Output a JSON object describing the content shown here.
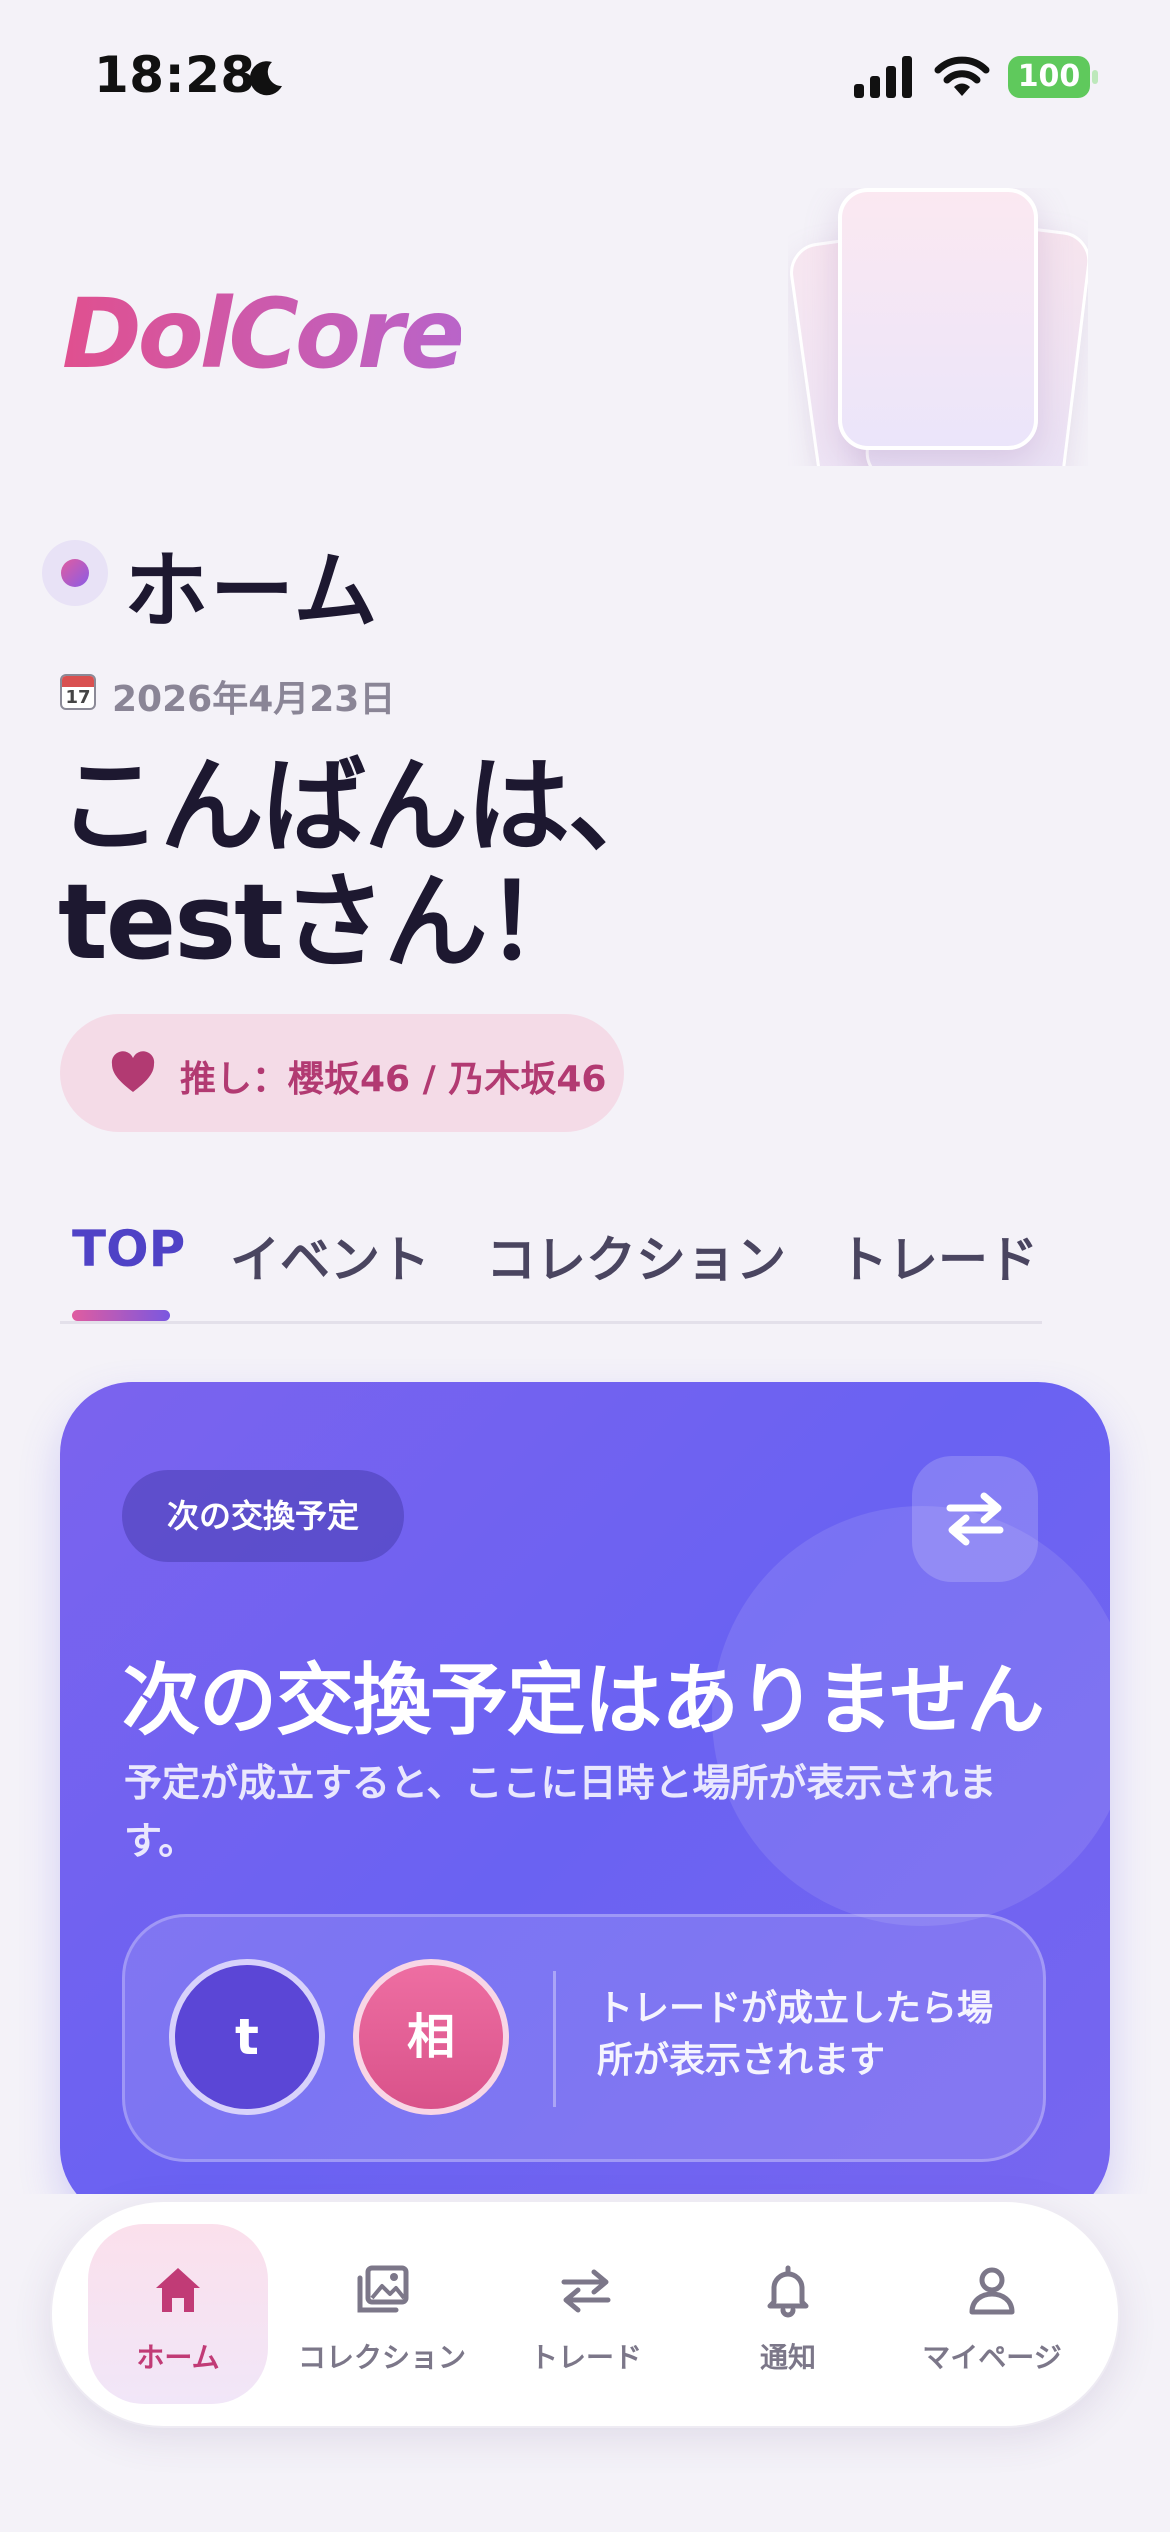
{
  "status_bar": {
    "time": "18:28",
    "battery": "100"
  },
  "header": {
    "brand": "DolCore",
    "title": "ホーム",
    "date_icon_num": "17",
    "date": "2026年4月23日",
    "greeting_line1": "こんばんは、",
    "greeting_line2": "testさん！",
    "oshi": "推し：櫻坂46 / 乃木坂46"
  },
  "tabs": [
    {
      "label": "TOP",
      "active": true
    },
    {
      "label": "イベント",
      "active": false
    },
    {
      "label": "コレクション",
      "active": false
    },
    {
      "label": "トレード",
      "active": false
    }
  ],
  "next_exchange": {
    "badge": "次の交換予定",
    "headline": "次の交換予定はありません",
    "description": "予定が成立すると、ここに日時と場所が表示されます。",
    "user_initial": "t",
    "partner_initial": "相",
    "partner_text": "トレードが成立したら場所が表示されます"
  },
  "bottom_nav": [
    {
      "label": "ホーム",
      "icon": "home-icon",
      "active": true
    },
    {
      "label": "コレクション",
      "icon": "gallery-icon",
      "active": false
    },
    {
      "label": "トレード",
      "icon": "swap-icon",
      "active": false
    },
    {
      "label": "通知",
      "icon": "bell-icon",
      "active": false
    },
    {
      "label": "マイページ",
      "icon": "user-icon",
      "active": false
    }
  ],
  "colors": {
    "accent_pink": "#d9509a",
    "accent_purple": "#6a62f2",
    "active_tab": "#4f42c6",
    "background": "#f4f2f8"
  }
}
